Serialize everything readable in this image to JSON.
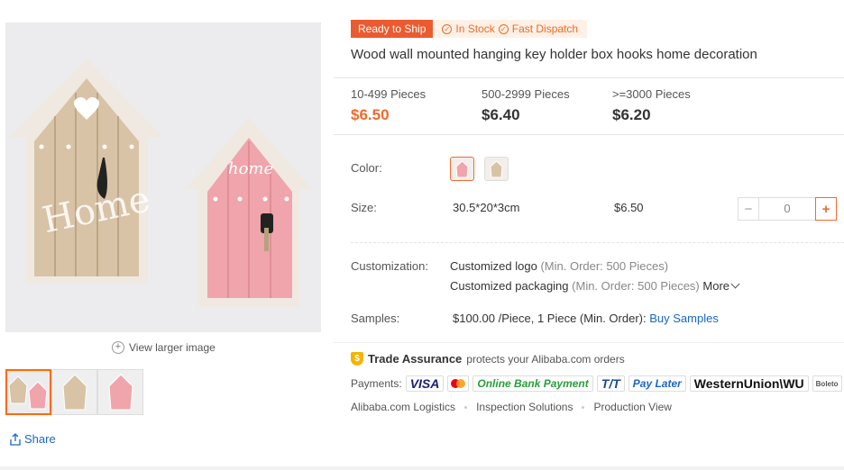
{
  "gallery": {
    "view_larger": "View larger image",
    "share": "Share",
    "thumbnails": [
      "thumbnail-1",
      "thumbnail-2",
      "thumbnail-3"
    ]
  },
  "badges": {
    "ready_to_ship": "Ready to Ship",
    "in_stock": "In Stock",
    "fast_dispatch": "Fast Dispatch"
  },
  "product": {
    "title": "Wood wall mounted hanging key holder box hooks home decoration"
  },
  "price_tiers": [
    {
      "range": "10-499 Pieces",
      "price": "$6.50"
    },
    {
      "range": "500-2999 Pieces",
      "price": "$6.40"
    },
    {
      "range": ">=3000 Pieces",
      "price": "$6.20"
    }
  ],
  "options": {
    "color_label": "Color:",
    "size_label": "Size:",
    "size_value": "30.5*20*3cm",
    "size_price": "$6.50",
    "quantity": "0"
  },
  "customization": {
    "label": "Customization:",
    "logo": "Customized logo",
    "logo_min": "(Min. Order: 500 Pieces)",
    "packaging": "Customized packaging",
    "packaging_min": "(Min. Order: 500 Pieces)",
    "more": "More"
  },
  "samples": {
    "label": "Samples:",
    "value": "$100.00 /Piece, 1 Piece (Min. Order):",
    "link": "Buy Samples"
  },
  "trade_assurance": {
    "name": "Trade Assurance",
    "text": "protects your Alibaba.com orders",
    "payments_label": "Payments:",
    "methods": [
      "VISA",
      "Online Bank Payment",
      "T/T",
      "Pay Later",
      "WesternUnion\\WU",
      "Boleto"
    ]
  },
  "logistics": [
    "Alibaba.com Logistics",
    "Inspection Solutions",
    "Production View"
  ],
  "colors": {
    "accent": "#f06a2e",
    "link": "#1a66c6",
    "pink": "#f3a5ad",
    "wood": "#d9c2a4"
  }
}
